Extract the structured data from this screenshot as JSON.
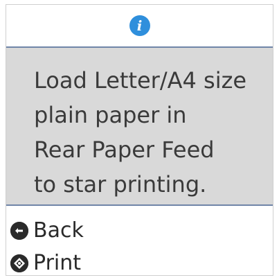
{
  "header": {
    "icon": "info-icon",
    "icon_glyph": "i",
    "icon_color": "#2f8fdc"
  },
  "message": {
    "lines": [
      "Load Letter/A4 size",
      "plain paper in",
      "Rear Paper Feed",
      "to star printing."
    ],
    "background": "#d9d9d9"
  },
  "actions": {
    "back": {
      "icon": "back-button-icon",
      "label": "Back"
    },
    "print": {
      "icon": "start-button-icon",
      "label": "Print"
    }
  },
  "colors": {
    "divider": "#6f85a8",
    "text": "#3a3a3a"
  }
}
